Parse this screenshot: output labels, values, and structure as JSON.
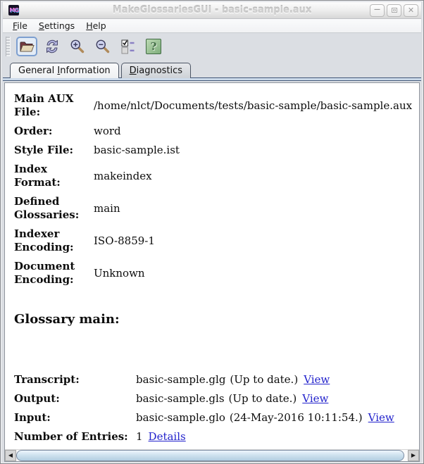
{
  "window": {
    "title": "MakeGlossariesGUI - basic-sample.aux",
    "app_icon_text": "MG",
    "controls": {
      "minimize_glyph": "—",
      "close_glyph": "✕"
    }
  },
  "menubar": {
    "items": [
      {
        "pre": "",
        "mn": "F",
        "post": "ile"
      },
      {
        "pre": "",
        "mn": "S",
        "post": "ettings"
      },
      {
        "pre": "",
        "mn": "H",
        "post": "elp"
      }
    ]
  },
  "toolbar": {
    "buttons": [
      "open",
      "reload",
      "zoom-in",
      "zoom-out",
      "diagnostics",
      "help"
    ],
    "help_glyph": "?"
  },
  "tabs": {
    "general": {
      "pre": "General ",
      "mn": "I",
      "post": "nformation"
    },
    "diagnostics": {
      "pre": "",
      "mn": "D",
      "post": "iagnostics"
    }
  },
  "fields": [
    {
      "label": "Main AUX File:",
      "value": "/home/nlct/Documents/tests/basic-sample/basic-sample.aux"
    },
    {
      "label": "Order:",
      "value": "word"
    },
    {
      "label": "Style File:",
      "value": "basic-sample.ist"
    },
    {
      "label": "Index Format:",
      "value": "makeindex"
    },
    {
      "label": "Defined Glossaries:",
      "value": "main"
    },
    {
      "label": "Indexer Encoding:",
      "value": "ISO-8859-1"
    },
    {
      "label": "Document Encoding:",
      "value": "Unknown"
    }
  ],
  "glossary": {
    "heading": "Glossary main:",
    "rows": [
      {
        "label": "Transcript:",
        "value": "basic-sample.glg",
        "status": "(Up to date.)",
        "link": "View"
      },
      {
        "label": "Output:",
        "value": "basic-sample.gls",
        "status": "(Up to date.)",
        "link": "View"
      },
      {
        "label": "Input:",
        "value": "basic-sample.glo",
        "status": "(24-May-2016 10:11:54.)",
        "link": "View"
      },
      {
        "label": "Number of Entries:",
        "value": "1",
        "status": "",
        "link": "Details"
      }
    ]
  },
  "scrollbar": {
    "left_arrow": "◀",
    "right_arrow": "▶"
  },
  "colors": {
    "link_blue": "#2323cc",
    "focus_ring_blue": "#7d9fd0",
    "help_green": "#7fae7c",
    "tab_band_line": "#44597a",
    "tab_band_fill": "#ccdaea",
    "scroll_thumb_blue": "#cfe2ef",
    "window_bg": "#dbdee3"
  }
}
